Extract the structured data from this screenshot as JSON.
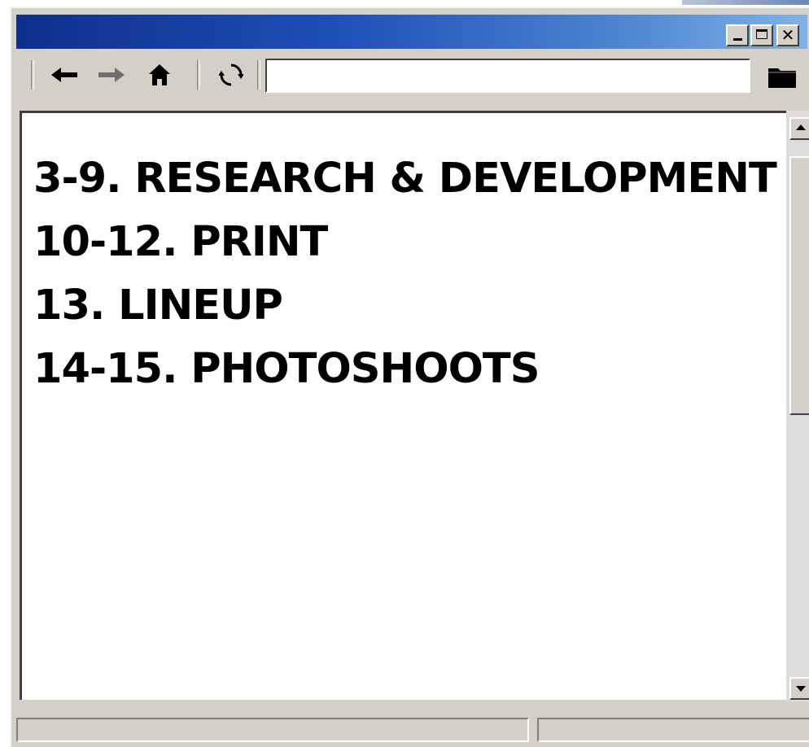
{
  "window": {
    "title": "",
    "title_gradient": [
      "#0e2f8c",
      "#7fb2e6"
    ],
    "face_color": "#d4d0c8",
    "controls": {
      "minimize_icon": "minimize-icon",
      "maximize_icon": "maximize-icon",
      "close_icon": "close-icon",
      "close_glyph": "✕"
    }
  },
  "toolbar": {
    "icons": [
      "back-arrow-icon",
      "forward-arrow-icon",
      "home-icon",
      "refresh-icon",
      "folder-icon"
    ],
    "address": {
      "value": "",
      "placeholder": ""
    }
  },
  "content": {
    "items": [
      {
        "label": "3-9. RESEARCH & DEVELOPMENT"
      },
      {
        "label": "10-12. PRINT"
      },
      {
        "label": "13. LINEUP"
      },
      {
        "label": "14-15. PHOTOSHOOTS"
      }
    ]
  },
  "scrollbar": {
    "position_fraction": 0.0,
    "visible_fraction": 0.45
  },
  "statusbar": {
    "left_text": "",
    "right_text": ""
  }
}
